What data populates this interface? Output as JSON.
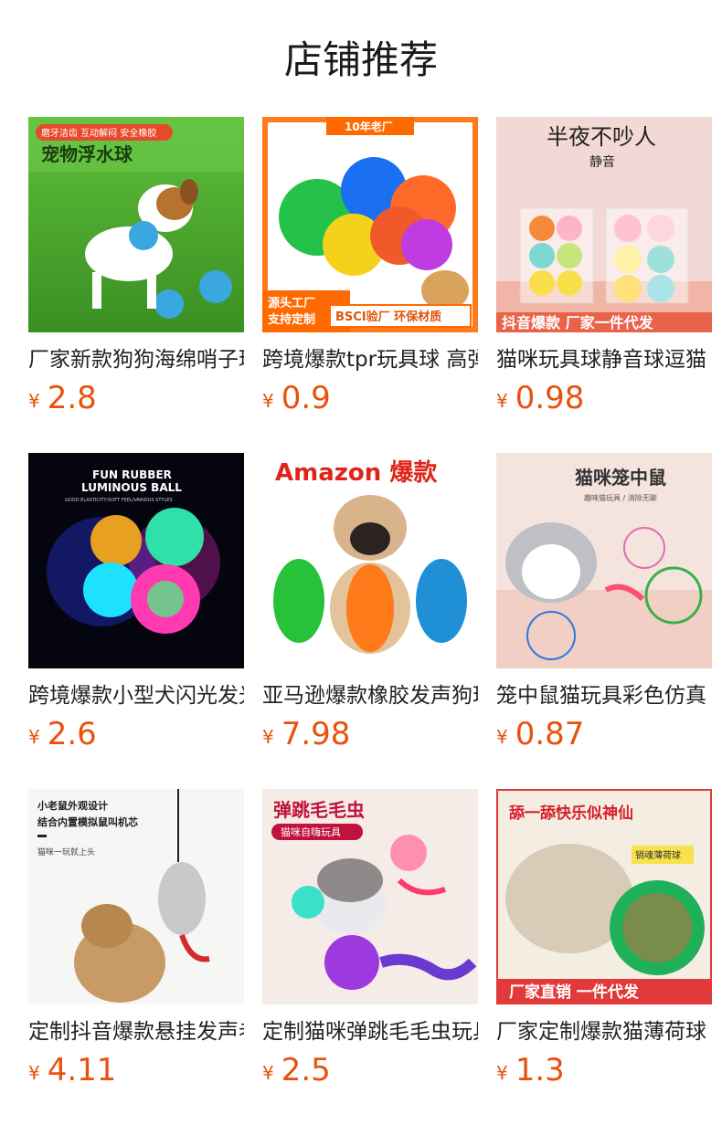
{
  "page": {
    "title": "店铺推荐"
  },
  "currency_symbol": "¥",
  "products": [
    {
      "name": "厂家新款狗狗海绵哨子球",
      "price": "2.8",
      "image": {
        "top_tag": "磨牙洁齿 互动解闷 安全橡胶",
        "headline": "宠物浮水球"
      }
    },
    {
      "name": "跨境爆款tpr玩具球 高弹",
      "price": "0.9",
      "image": {
        "top_tag": "10年老厂",
        "badge_left_1": "源头工厂",
        "badge_left_2": "支持定制",
        "badge_right": "BSCI验厂  环保材质"
      }
    },
    {
      "name": "猫咪玩具球静音球逗猫",
      "price": "0.98",
      "image": {
        "headline": "半夜不吵人",
        "sub": "静音",
        "banner": "抖音爆款  厂家一件代发"
      }
    },
    {
      "name": "跨境爆款小型犬闪光发光球",
      "price": "2.6",
      "image": {
        "line1": "FUN RUBBER",
        "line2": "LUMINOUS BALL",
        "line3": "GOOD ELASTICITY/SOFT FEEL/VARIOUS STYLES"
      }
    },
    {
      "name": "亚马逊爆款橡胶发声狗玩具",
      "price": "7.98",
      "image": {
        "headline": "Amazon 爆款"
      }
    },
    {
      "name": "笼中鼠猫玩具彩色仿真",
      "price": "0.87",
      "image": {
        "headline": "猫咪笼中鼠",
        "sub": "趣味猫玩具 / 消除无聊"
      }
    },
    {
      "name": "定制抖音爆款悬挂发声老鼠",
      "price": "4.11",
      "image": {
        "line1": "小老鼠外观设计",
        "line2": "结合内置模拟鼠叫机芯",
        "line3": "猫咪一玩就上头"
      }
    },
    {
      "name": "定制猫咪弹跳毛毛虫玩具",
      "price": "2.5",
      "image": {
        "headline": "弹跳毛毛虫",
        "sub": "猫咪自嗨玩具"
      }
    },
    {
      "name": "厂家定制爆款猫薄荷球",
      "price": "1.3",
      "image": {
        "headline": "舔一舔快乐似神仙",
        "tag": "销魂薄荷球",
        "banner": "厂家直销  一件代发"
      }
    }
  ]
}
